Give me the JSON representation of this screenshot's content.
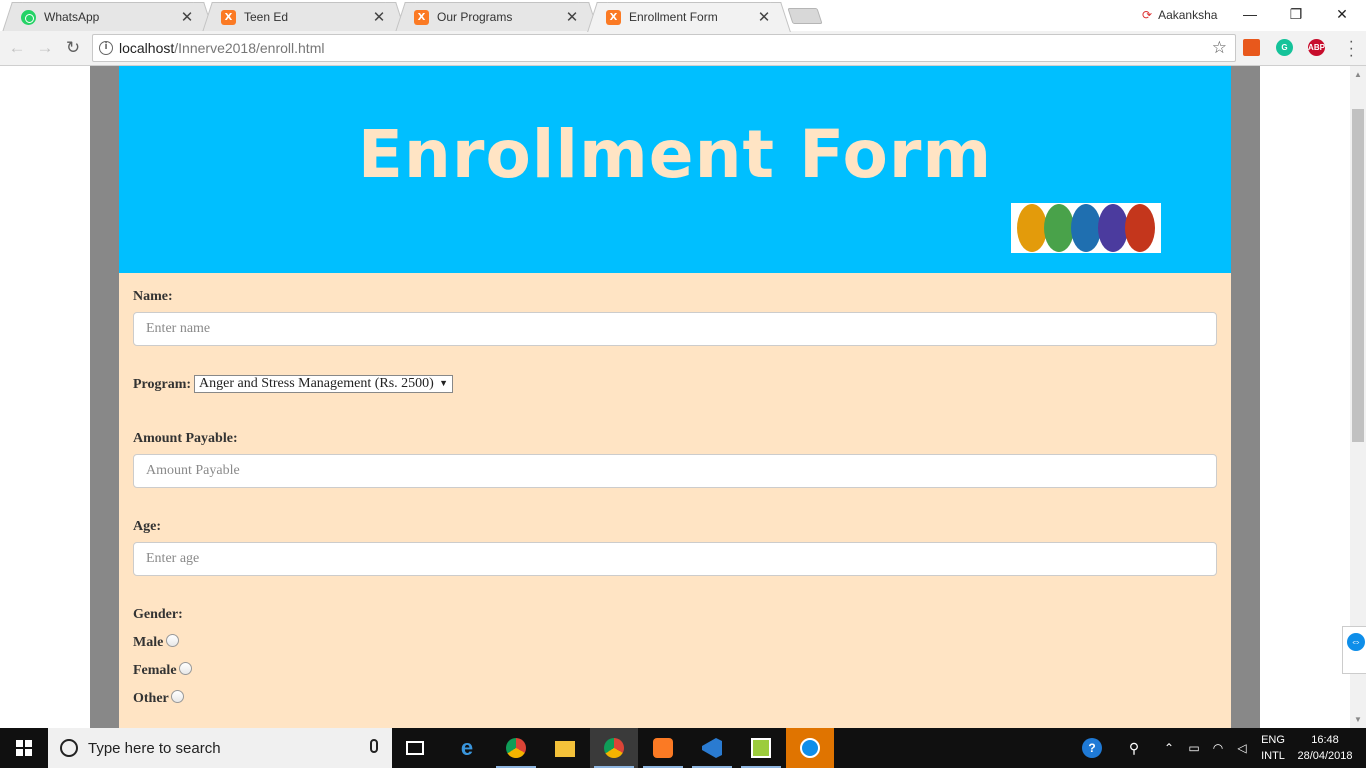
{
  "browser": {
    "tabs": [
      {
        "title": "WhatsApp",
        "favicon": "whatsapp-icon"
      },
      {
        "title": "Teen Ed",
        "favicon": "xampp-icon"
      },
      {
        "title": "Our Programs",
        "favicon": "xampp-icon"
      },
      {
        "title": "Enrollment Form",
        "favicon": "xampp-icon",
        "active": true
      }
    ],
    "profile_name": "Aakanksha",
    "url_host": "localhost",
    "url_path": "/Innerve2018/enroll.html",
    "extensions": [
      "office-icon",
      "grammarly-icon",
      "adblock-plus-icon"
    ],
    "adblock_label": "ABP"
  },
  "page": {
    "header_title": "Enrollment Form",
    "header_bg": "#00bfff",
    "header_text_color": "#ffe4c4",
    "form_bg": "#ffe4c4",
    "form": {
      "name_label": "Name:",
      "name_placeholder": "Enter name",
      "program_label": "Program:",
      "program_selected": "Anger and Stress Management (Rs. 2500)",
      "amount_label": "Amount Payable:",
      "amount_placeholder": "Amount Payable",
      "age_label": "Age:",
      "age_placeholder": "Enter age",
      "gender_label": "Gender:",
      "gender_options": [
        "Male",
        "Female",
        "Other"
      ]
    }
  },
  "taskbar": {
    "search_placeholder": "Type here to search",
    "apps": [
      "task-view-icon",
      "edge-icon",
      "chrome-icon",
      "file-explorer-icon",
      "chrome-icon",
      "xampp-icon",
      "visual-studio-icon",
      "notepad-plus-icon",
      "teamviewer-icon"
    ],
    "language_line1": "ENG",
    "language_line2": "INTL",
    "time": "16:48",
    "date": "28/04/2018"
  }
}
